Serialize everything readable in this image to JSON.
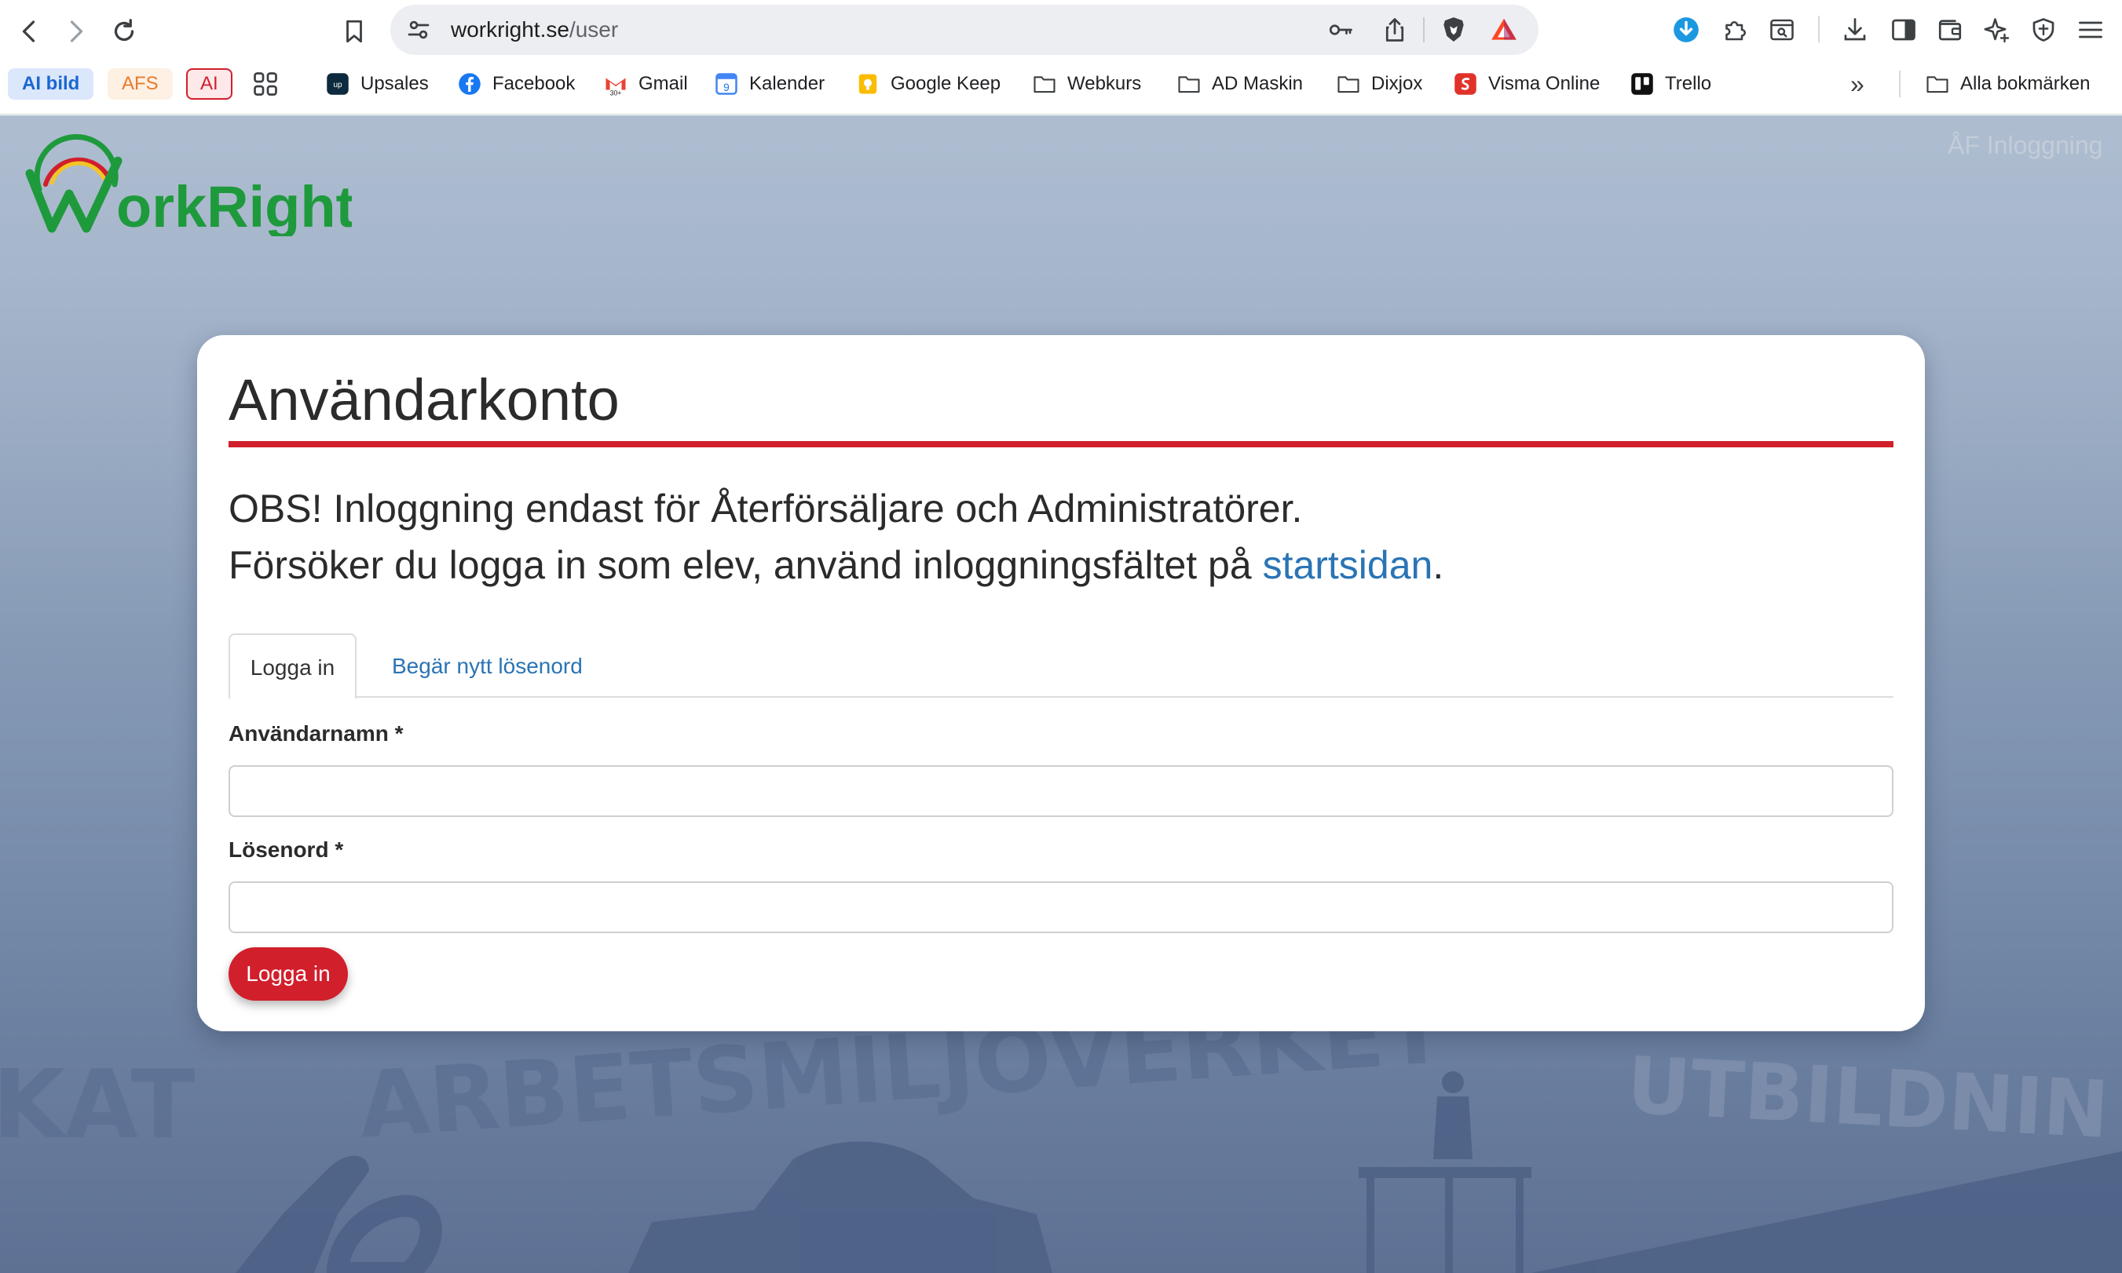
{
  "browser": {
    "url_host": "workright.se",
    "url_path": "/user",
    "icons": {
      "back": "back-arrow-icon",
      "forward": "forward-arrow-icon",
      "reload": "reload-icon",
      "bookmark": "bookmark-icon",
      "site": "site-settings-icon",
      "password": "key-icon",
      "share": "share-icon",
      "brave": "brave-shield-icon",
      "rewards": "rewards-triangle-icon"
    }
  },
  "bookmarks": {
    "pills": [
      "AI bild",
      "AFS",
      "AI"
    ],
    "items": [
      "Upsales",
      "Facebook",
      "Gmail",
      "Kalender",
      "Google Keep",
      "Webkurs",
      "AD Maskin",
      "Dixjox",
      "Visma Online",
      "Trello"
    ],
    "overflow_label": "»",
    "all_bookmarks": "Alla bokmärken"
  },
  "page": {
    "corner_link": "ÅF Inloggning",
    "logo_text": "WorkRight",
    "background_words": [
      "KAT",
      "ARBETSMILJÖVERKET",
      "UTBILDNIN"
    ]
  },
  "card": {
    "title": "Användarkonto",
    "notice_line1": "OBS! Inloggning endast för Återförsäljare och Administratörer.",
    "notice_line2_prefix": "Försöker du logga in som elev, använd inloggningsfältet på ",
    "notice_link": "startsidan",
    "notice_line2_suffix": "."
  },
  "tabs": {
    "active": "Logga in",
    "inactive": "Begär nytt lösenord"
  },
  "form": {
    "username_label": "Användarnamn",
    "password_label": "Lösenord",
    "required_marker": "*",
    "username_value": "",
    "password_value": "",
    "submit_label": "Logga in"
  },
  "colors": {
    "brand_red": "#d11f2c",
    "link_blue": "#2a74b5",
    "logo_green": "#1e9a3c"
  }
}
